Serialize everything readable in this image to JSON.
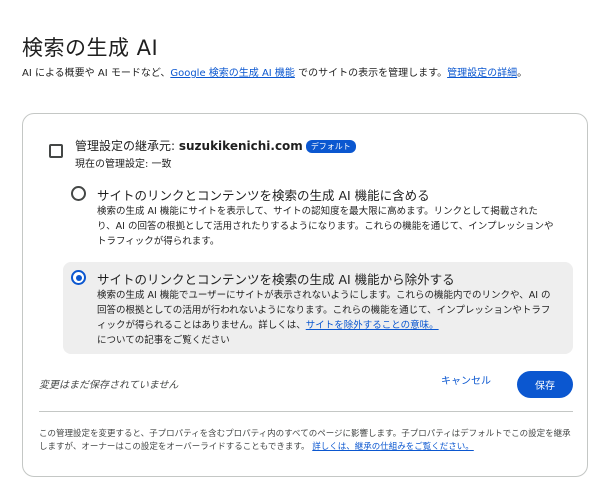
{
  "page": {
    "title": "検索の生成 AI",
    "desc_prefix": "AI による概要や AI モードなど、",
    "desc_link1": "Google 検索の生成 AI 機能",
    "desc_middle": " でのサイトの表示を管理します。",
    "desc_link2": "管理設定の詳細",
    "desc_suffix": "。"
  },
  "inherit": {
    "label_prefix": "管理設定の継承元: ",
    "domain": "suzukikenichi.com",
    "badge": "デフォルト",
    "current": "現在の管理設定: 一致",
    "checked": false
  },
  "options": [
    {
      "title": "サイトのリンクとコンテンツを検索の生成 AI 機能に含める",
      "desc": "検索の生成 AI 機能にサイトを表示して、サイトの認知度を最大限に高めます。リンクとして掲載されたり、AI の回答の根拠として活用されたりするようになります。これらの機能を通じて、インプレッションやトラフィックが得られます。",
      "selected": false
    },
    {
      "title": "サイトのリンクとコンテンツを検索の生成 AI 機能から除外する",
      "desc_prefix": "検索の生成 AI 機能でユーザーにサイトが表示されないようにします。これらの機能内でのリンクや、AI の回答の根拠としての活用が行われないようになります。これらの機能を通じて、インプレッションやトラフィックが得られることはありません。詳しくは、",
      "desc_link": "サイトを除外することの意味。",
      "desc_suffix": "についての記事をご覧ください",
      "selected": true
    }
  ],
  "footer": {
    "unsaved": "変更はまだ保存されていません",
    "cancel": "キャンセル",
    "save": "保存",
    "note": "この管理設定を変更すると、子プロパティを含むプロパティ内のすべてのページに影響します。子プロパティはデフォルトでこの設定を継承しますが、オーナーはこの設定をオーバーライドすることもできます。",
    "note_link": "詳しくは、継承の仕組みをご覧ください。"
  },
  "colors": {
    "accent": "#0b57d0",
    "selected_bg": "#eeeeee",
    "border": "#c4c7c5"
  }
}
